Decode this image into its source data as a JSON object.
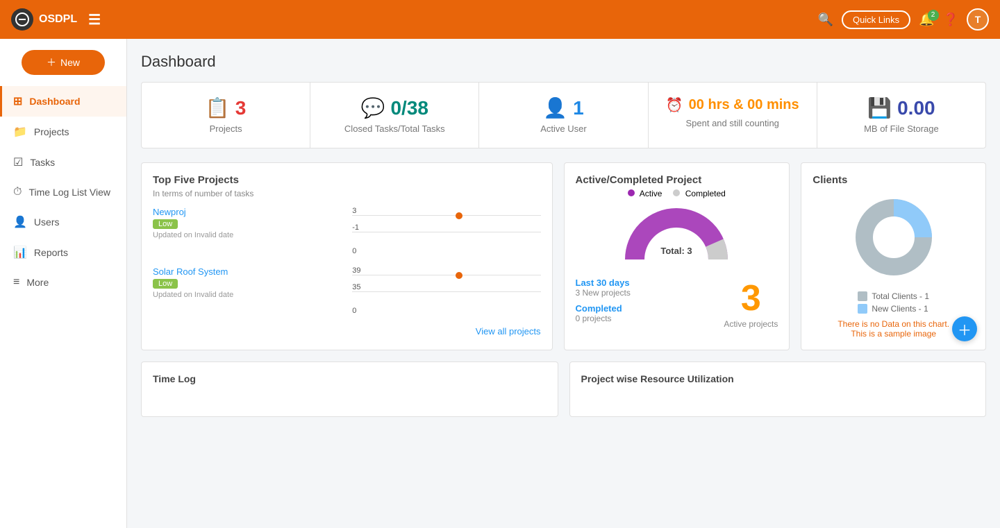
{
  "app": {
    "name": "OSDPL",
    "logo_char": "O"
  },
  "header": {
    "quick_links": "Quick Links",
    "notif_count": "2",
    "user_initial": "T"
  },
  "new_button": {
    "label": "New"
  },
  "sidebar": {
    "items": [
      {
        "id": "dashboard",
        "label": "Dashboard",
        "icon": "⊞",
        "active": true
      },
      {
        "id": "projects",
        "label": "Projects",
        "icon": "📁",
        "active": false
      },
      {
        "id": "tasks",
        "label": "Tasks",
        "icon": "☑",
        "active": false
      },
      {
        "id": "timelog",
        "label": "Time Log List View",
        "icon": "⏱",
        "active": false
      },
      {
        "id": "users",
        "label": "Users",
        "icon": "👤",
        "active": false
      },
      {
        "id": "reports",
        "label": "Reports",
        "icon": "📊",
        "active": false
      },
      {
        "id": "more",
        "label": "More",
        "icon": "≡",
        "active": false
      }
    ]
  },
  "page_title": "Dashboard",
  "stats": [
    {
      "icon": "📋",
      "value": "3",
      "label": "Projects",
      "color": "#e53935"
    },
    {
      "icon": "💬",
      "value": "0/38",
      "label": "Closed Tasks/Total Tasks",
      "color": "#00897b"
    },
    {
      "icon": "👤",
      "value": "1",
      "label": "Active User",
      "color": "#1e88e5"
    },
    {
      "icon": "⏰",
      "value": "00 hrs & 00 mins",
      "label": "Spent and still counting",
      "color": "#ff8f00"
    },
    {
      "icon": "💾",
      "value": "0.00",
      "label": "MB of File Storage",
      "color": "#3949ab"
    }
  ],
  "top_projects": {
    "title": "Top Five Projects",
    "subtitle": "In terms of number of tasks",
    "projects": [
      {
        "name": "Newproj",
        "tag": "Low",
        "date": "Updated on Invalid date",
        "max_val": "3",
        "min_val": "-1",
        "zero_val": "0"
      },
      {
        "name": "Solar Roof System",
        "tag": "Low",
        "date": "Updated on Invalid date",
        "max_val": "39",
        "min_val": "35",
        "zero_val": "0"
      }
    ],
    "view_all": "View all projects"
  },
  "active_completed": {
    "title": "Active/Completed Project",
    "legend_active": "Active",
    "legend_completed": "Completed",
    "donut_total": "Total: 3",
    "last30": "Last 30 days",
    "new_projects": "3 New projects",
    "active_count": "3",
    "active_count_label": "Active projects",
    "completed_label": "Completed",
    "completed_count": "0 projects"
  },
  "clients": {
    "title": "Clients",
    "legend": [
      {
        "label": "Total Clients - 1",
        "color": "#b0bec5"
      },
      {
        "label": "New Clients - 1",
        "color": "#90caf9"
      }
    ],
    "no_data_line1": "There is no Data on this chart.",
    "no_data_line2": "This is a sample image"
  },
  "bottom": [
    {
      "title": "Time Log"
    },
    {
      "title": "Project wise Resource Utilization"
    }
  ]
}
